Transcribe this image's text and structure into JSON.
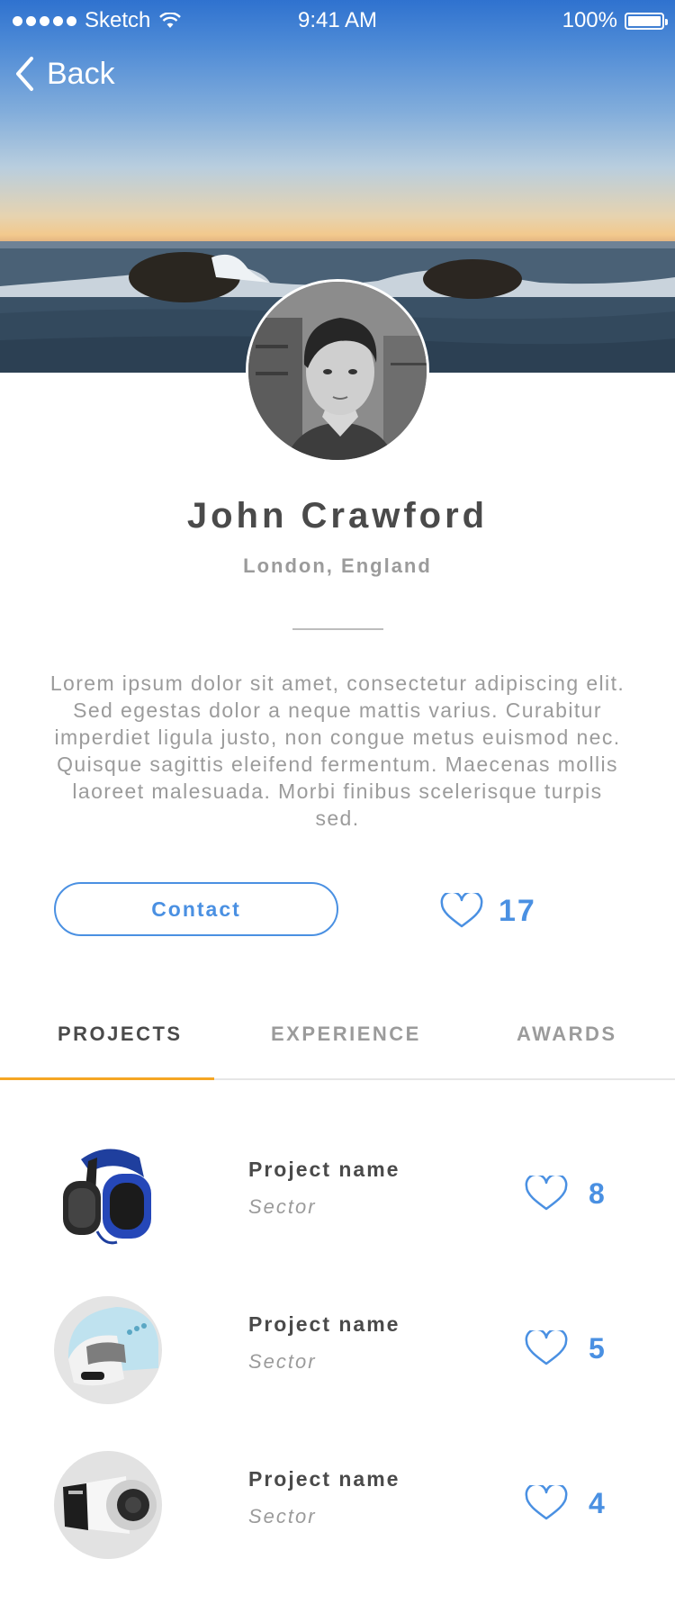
{
  "status_bar": {
    "carrier": "Sketch",
    "time": "9:41 AM",
    "battery": "100%"
  },
  "nav": {
    "back_label": "Back"
  },
  "profile": {
    "name": "John Crawford",
    "location": "London, England",
    "bio": "Lorem ipsum dolor sit amet, consectetur adipiscing elit. Sed egestas dolor a neque mattis varius. Curabitur imperdiet ligula justo, non congue metus euismod nec. Quisque sagittis eleifend fermentum. Maecenas mollis laoreet malesuada. Morbi finibus scelerisque turpis sed.",
    "contact_label": "Contact",
    "likes": "17"
  },
  "tabs": [
    {
      "label": "PROJECTS",
      "active": true
    },
    {
      "label": "EXPERIENCE",
      "active": false
    },
    {
      "label": "AWARDS",
      "active": false
    }
  ],
  "projects": [
    {
      "name": "Project name",
      "sector": "Sector",
      "likes": "8",
      "image": "headphones"
    },
    {
      "name": "Project name",
      "sector": "Sector",
      "likes": "5",
      "image": "helmet"
    },
    {
      "name": "Project name",
      "sector": "Sector",
      "likes": "4",
      "image": "hair-dryer"
    }
  ],
  "colors": {
    "accent": "#4a90e2",
    "tab_indicator": "#f5a623",
    "text_dark": "#4a4a4a",
    "text_muted": "#9b9b9b"
  }
}
